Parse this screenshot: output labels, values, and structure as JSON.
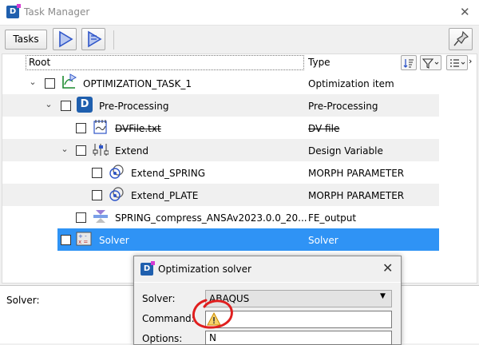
{
  "window": {
    "title": "Task Manager",
    "close_glyph": "✕",
    "logo_text": "D"
  },
  "toolbar": {
    "tasks_label": "Tasks",
    "play_icon": "play-icon",
    "play_step_icon": "play-step-icon",
    "pin_icon": "pin-icon"
  },
  "tree": {
    "columns": {
      "root": "Root",
      "type": "Type"
    },
    "rows": [
      {
        "label": "OPTIMIZATION_TASK_1",
        "type": "Optimization item"
      },
      {
        "label": "Pre-Processing",
        "type": "Pre-Processing"
      },
      {
        "label": "DVFile.txt",
        "type": "DV file"
      },
      {
        "label": "Extend",
        "type": "Design Variable"
      },
      {
        "label": "Extend_SPRING",
        "type": "MORPH PARAMETER"
      },
      {
        "label": "Extend_PLATE",
        "type": "MORPH PARAMETER"
      },
      {
        "label": "SPRING_compress_ANSAv2023.0.0_20...",
        "type": "FE_output"
      },
      {
        "label": "Solver",
        "type": "Solver"
      }
    ]
  },
  "bottom": {
    "solver_label": "Solver:"
  },
  "dialog": {
    "title": "Optimization solver",
    "close_glyph": "✕",
    "solver_label": "Solver:",
    "solver_value": "ABAQUS",
    "command_label": "Command:",
    "options_label": "Options:",
    "options_value": "N"
  },
  "colors": {
    "selection": "#2f93f5",
    "annotation": "#e01e1e",
    "warning": "#f2b21b"
  }
}
